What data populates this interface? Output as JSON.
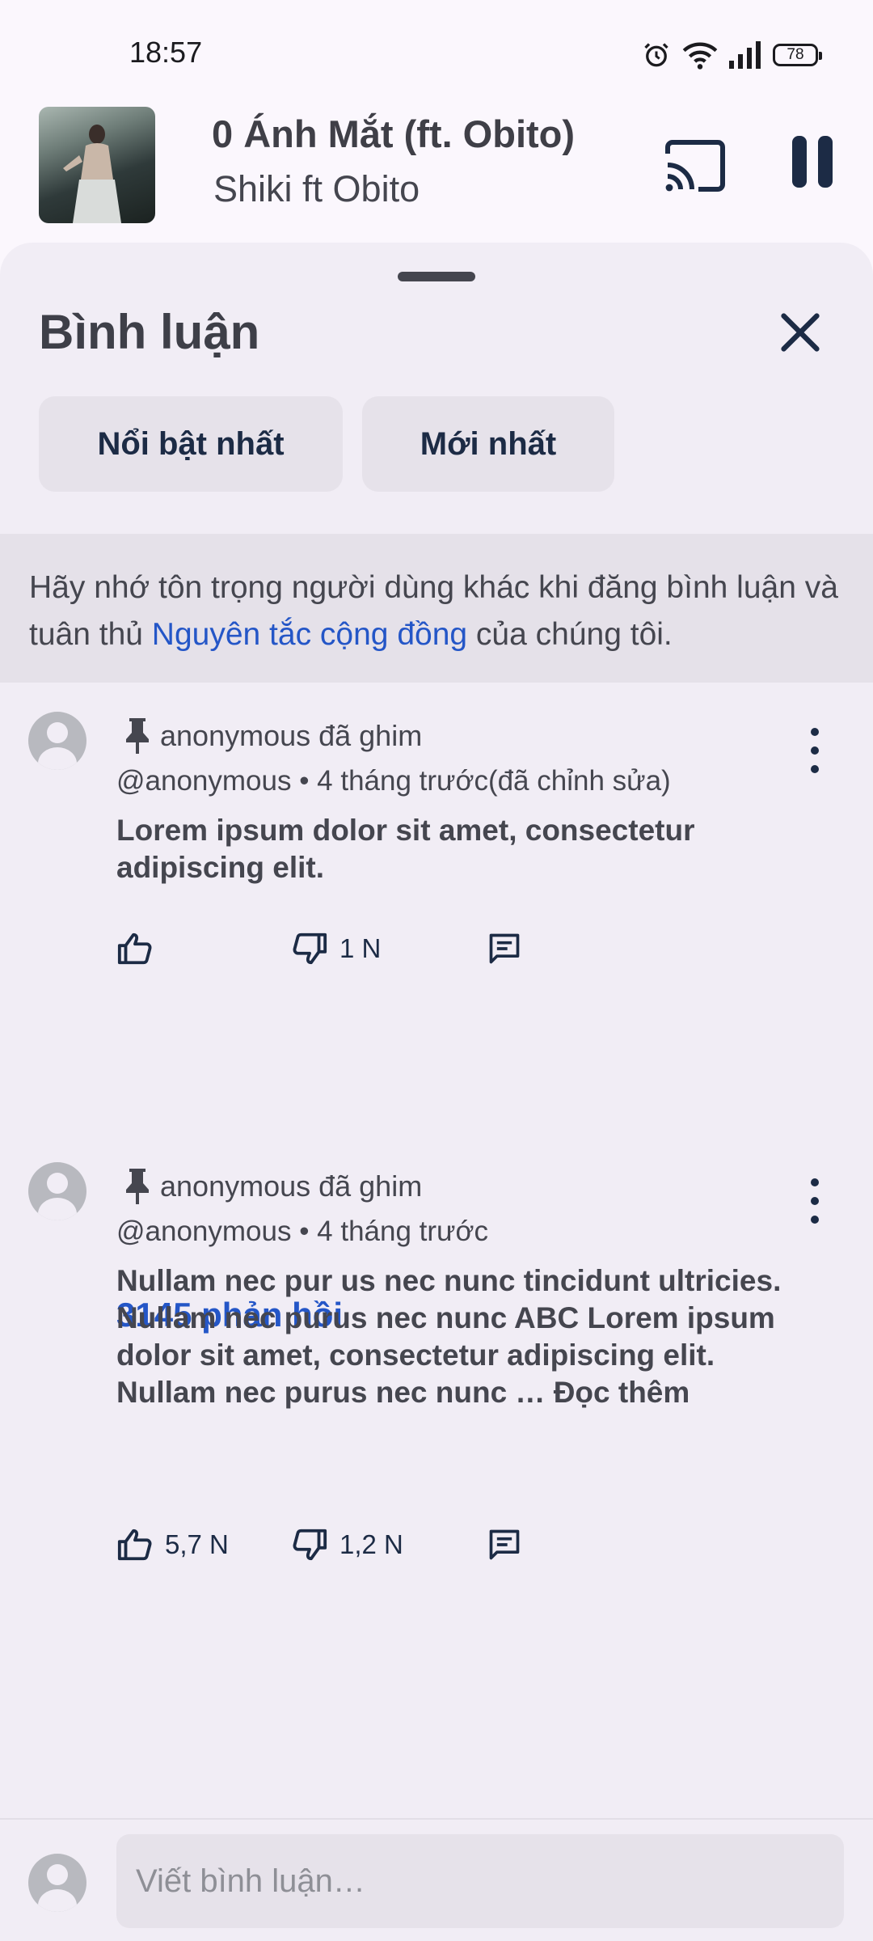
{
  "status": {
    "time": "18:57",
    "battery": "78"
  },
  "player": {
    "title": "0 Ánh Mắt (ft. Obito)",
    "artist": "Shiki ft Obito"
  },
  "sheet": {
    "title": "Bình luận",
    "chips": [
      "Nổi bật nhất",
      "Mới nhất"
    ],
    "notice_prefix": "Hãy nhớ tôn trọng người dùng khác khi đăng bình luận và tuân thủ ",
    "notice_link": "Nguyên tắc cộng đồng",
    "notice_suffix": " của chúng tôi."
  },
  "comments": [
    {
      "pinned_label": "anonymous đã ghim",
      "meta": "@anonymous • 4 tháng trước(đã chỉnh sửa)",
      "text": "Lorem ipsum dolor sit amet, consectetur adipiscing elit.",
      "likes": "",
      "dislikes": "1 N",
      "replies": "3145 phản hồi"
    },
    {
      "pinned_label": "anonymous đã ghim",
      "meta": "@anonymous • 4 tháng trước",
      "text": "Nullam nec pur us nec nunc tincidunt ultricies. Nullam nec purus nec nunc ABC Lorem ipsum dolor sit amet, consectetur adipiscing elit. Nullam nec purus nec nunc … Đọc thêm",
      "likes": "5,7 N",
      "dislikes": "1,2 N"
    }
  ],
  "composer": {
    "placeholder": "Viết bình luận…"
  },
  "icons": {
    "alarm": "alarm-icon",
    "wifi": "wifi-icon",
    "signal": "signal-icon",
    "battery": "battery-icon",
    "cast": "cast-icon",
    "pause": "pause-icon",
    "close": "close-icon",
    "pin": "pin-icon",
    "more": "more-vert-icon",
    "like": "thumb-up-icon",
    "dislike": "thumb-down-icon",
    "reply": "comment-icon"
  },
  "colors": {
    "accent_link": "#2456c7",
    "background": "#fbf7fd",
    "sheet": "#f1edf5"
  }
}
